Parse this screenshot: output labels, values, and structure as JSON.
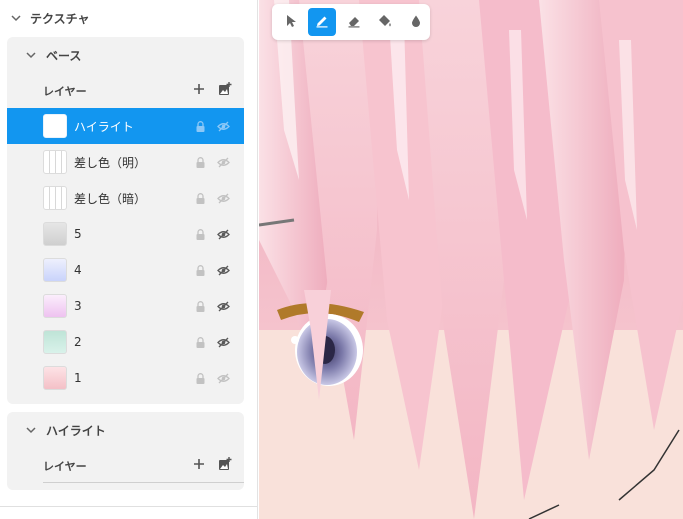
{
  "panel": {
    "title": "テクスチャ",
    "groups": [
      {
        "title": "ベース",
        "layers_label": "レイヤー",
        "layers": [
          {
            "name": "ハイライト",
            "selected": true,
            "visible": false,
            "thumb": "#ffffff"
          },
          {
            "name": "差し色（明）",
            "selected": false,
            "visible": false,
            "thumb": "stripes"
          },
          {
            "name": "差し色（暗）",
            "selected": false,
            "visible": false,
            "thumb": "stripes"
          },
          {
            "name": "5",
            "selected": false,
            "visible": true,
            "thumb": "#d9d9d9"
          },
          {
            "name": "4",
            "selected": false,
            "visible": true,
            "thumb": "#d5dcfb"
          },
          {
            "name": "3",
            "selected": false,
            "visible": true,
            "thumb": "#f2cdf3"
          },
          {
            "name": "2",
            "selected": false,
            "visible": true,
            "thumb": "#c7ece0"
          },
          {
            "name": "1",
            "selected": false,
            "visible": false,
            "thumb": "#f9d2d6"
          }
        ]
      },
      {
        "title": "ハイライト",
        "layers_label": "レイヤー",
        "layers": []
      }
    ]
  },
  "toolbar": {
    "tools": [
      "select-icon",
      "pen-icon",
      "eraser-icon",
      "fill-icon",
      "drop-icon"
    ],
    "active_tool": "pen-icon"
  },
  "colors": {
    "accent": "#1296f0",
    "card": "#f2f2f2",
    "hair_pink": "#f4bfcb"
  }
}
